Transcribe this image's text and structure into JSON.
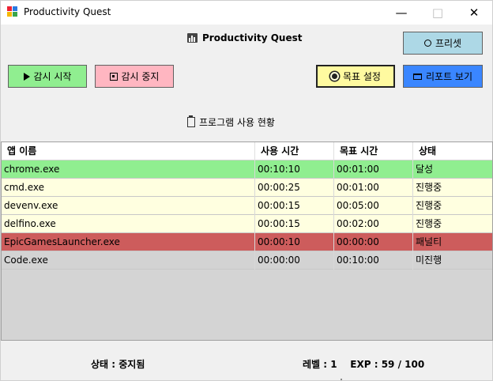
{
  "window": {
    "title": "Productivity Quest"
  },
  "header": {
    "title": "Productivity Quest"
  },
  "buttons": {
    "preset": "프리셋",
    "start": "감시 시작",
    "stop": "감시 중지",
    "goal": "목표 설정",
    "report": "리포트 보기"
  },
  "section": {
    "title": "프로그램 사용 현황"
  },
  "table": {
    "columns": [
      "앱 이름",
      "사용 시간",
      "목표 시간",
      "상태"
    ],
    "rows": [
      {
        "app": "chrome.exe",
        "used": "00:10:10",
        "goal": "00:01:00",
        "status": "달성",
        "color": "#90ee90"
      },
      {
        "app": "cmd.exe",
        "used": "00:00:25",
        "goal": "00:01:00",
        "status": "진행중",
        "color": "#ffffe0"
      },
      {
        "app": "devenv.exe",
        "used": "00:00:15",
        "goal": "00:05:00",
        "status": "진행중",
        "color": "#ffffe0"
      },
      {
        "app": "delfino.exe",
        "used": "00:00:15",
        "goal": "00:02:00",
        "status": "진행중",
        "color": "#ffffe0"
      },
      {
        "app": "EpicGamesLauncher.exe",
        "used": "00:00:10",
        "goal": "00:00:00",
        "status": "패널티",
        "color": "#cd5c5c"
      },
      {
        "app": "Code.exe",
        "used": "00:00:00",
        "goal": "00:10:00",
        "status": "미진행",
        "color": "#d3d3d3"
      }
    ]
  },
  "status_bar": {
    "state": "상태 : 중지됨",
    "level_exp": "레벨 : 1    EXP : 59 / 100"
  },
  "icons": {
    "app": "app-icon",
    "minimize": "minimize-icon",
    "maximize": "maximize-icon",
    "close": "close-icon"
  }
}
